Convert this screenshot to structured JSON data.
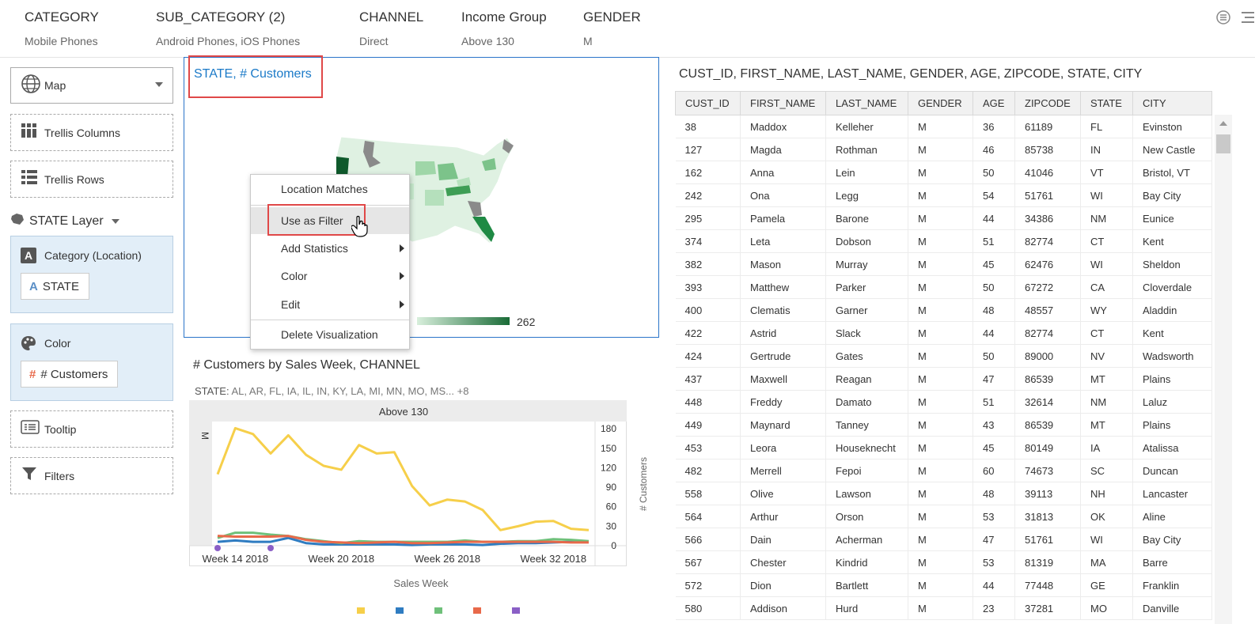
{
  "filters": [
    {
      "title": "CATEGORY",
      "value": "Mobile Phones"
    },
    {
      "title": "SUB_CATEGORY (2)",
      "value": "Android Phones, iOS Phones"
    },
    {
      "title": "CHANNEL",
      "value": "Direct"
    },
    {
      "title": "Income Group",
      "value": "Above 130"
    },
    {
      "title": "GENDER",
      "value": "M"
    }
  ],
  "left": {
    "map_label": "Map",
    "trellis_columns": "Trellis Columns",
    "trellis_rows": "Trellis Rows",
    "layer": "STATE Layer",
    "category_hdr": "Category (Location)",
    "category_pill": "STATE",
    "color_hdr": "Color",
    "color_pill": "# Customers",
    "tooltip": "Tooltip",
    "filters": "Filters"
  },
  "map": {
    "title": "STATE, # Customers",
    "legend_max": "262"
  },
  "context_menu": {
    "items": [
      "Location Matches",
      "Use as Filter",
      "Add Statistics",
      "Color",
      "Edit",
      "Delete Visualization"
    ]
  },
  "line": {
    "title": "# Customers by Sales Week, CHANNEL",
    "subtitle_label": "STATE:",
    "subtitle_value": "AL, AR, FL, IA, IL, IN, KY, LA, MI, MN, MO, MS... +8"
  },
  "chart_data": {
    "type": "line",
    "column_header": "Above 130",
    "row_header": "M",
    "xlabel": "Sales Week",
    "ylabel": "# Customers",
    "x_tick_labels": [
      "Week 14 2018",
      "Week 20 2018",
      "Week 26 2018",
      "Week 32 2018"
    ],
    "y_ticks": [
      0,
      30,
      60,
      90,
      120,
      150,
      180
    ],
    "ylim": [
      0,
      190
    ],
    "series": [
      {
        "color": "#f6cf4a",
        "values": [
          110,
          181,
          172,
          142,
          170,
          140,
          123,
          117,
          155,
          142,
          144,
          92,
          62,
          71,
          68,
          55,
          24,
          30,
          37,
          38,
          26,
          24
        ]
      },
      {
        "color": "#2f7cc1",
        "values": [
          6,
          8,
          6,
          6,
          12,
          4,
          2,
          2,
          2,
          2,
          2,
          1,
          2,
          2,
          2,
          1,
          3,
          4,
          4,
          5,
          6,
          6
        ]
      },
      {
        "color": "#6fc07a",
        "values": [
          12,
          20,
          20,
          17,
          15,
          10,
          7,
          4,
          7,
          6,
          6,
          6,
          6,
          6,
          8,
          6,
          6,
          7,
          7,
          10,
          9,
          7
        ]
      },
      {
        "color": "#e8694a",
        "values": [
          15,
          14,
          14,
          14,
          15,
          9,
          6,
          5,
          4,
          5,
          6,
          4,
          4,
          5,
          6,
          6,
          6,
          6,
          6,
          6,
          5,
          5
        ]
      },
      {
        "color": "#8a5fc6",
        "values": [
          0,
          null,
          null,
          0,
          null,
          null,
          null,
          null,
          null,
          null,
          null,
          null,
          null,
          null,
          null,
          null,
          null,
          null,
          null,
          null,
          null,
          null
        ]
      }
    ]
  },
  "table": {
    "title": "CUST_ID, FIRST_NAME, LAST_NAME, GENDER, AGE, ZIPCODE, STATE, CITY",
    "columns": [
      "CUST_ID",
      "FIRST_NAME",
      "LAST_NAME",
      "GENDER",
      "AGE",
      "ZIPCODE",
      "STATE",
      "CITY"
    ],
    "rows": [
      [
        "38",
        "Maddox",
        "Kelleher",
        "M",
        "36",
        "61189",
        "FL",
        "Evinston"
      ],
      [
        "127",
        "Magda",
        "Rothman",
        "M",
        "46",
        "85738",
        "IN",
        "New Castle"
      ],
      [
        "162",
        "Anna",
        "Lein",
        "M",
        "50",
        "41046",
        "VT",
        "Bristol, VT"
      ],
      [
        "242",
        "Ona",
        "Legg",
        "M",
        "54",
        "51761",
        "WI",
        "Bay City"
      ],
      [
        "295",
        "Pamela",
        "Barone",
        "M",
        "44",
        "34386",
        "NM",
        "Eunice"
      ],
      [
        "374",
        "Leta",
        "Dobson",
        "M",
        "51",
        "82774",
        "CT",
        "Kent"
      ],
      [
        "382",
        "Mason",
        "Murray",
        "M",
        "45",
        "62476",
        "WI",
        "Sheldon"
      ],
      [
        "393",
        "Matthew",
        "Parker",
        "M",
        "50",
        "67272",
        "CA",
        "Cloverdale"
      ],
      [
        "400",
        "Clematis",
        "Garner",
        "M",
        "48",
        "48557",
        "WY",
        "Aladdin"
      ],
      [
        "422",
        "Astrid",
        "Slack",
        "M",
        "44",
        "82774",
        "CT",
        "Kent"
      ],
      [
        "424",
        "Gertrude",
        "Gates",
        "M",
        "50",
        "89000",
        "NV",
        "Wadsworth"
      ],
      [
        "437",
        "Maxwell",
        "Reagan",
        "M",
        "47",
        "86539",
        "MT",
        "Plains"
      ],
      [
        "448",
        "Freddy",
        "Damato",
        "M",
        "51",
        "32614",
        "NM",
        "Laluz"
      ],
      [
        "449",
        "Maynard",
        "Tanney",
        "M",
        "43",
        "86539",
        "MT",
        "Plains"
      ],
      [
        "453",
        "Leora",
        "Houseknecht",
        "M",
        "45",
        "80149",
        "IA",
        "Atalissa"
      ],
      [
        "482",
        "Merrell",
        "Fepoi",
        "M",
        "60",
        "74673",
        "SC",
        "Duncan"
      ],
      [
        "558",
        "Olive",
        "Lawson",
        "M",
        "48",
        "39113",
        "NH",
        "Lancaster"
      ],
      [
        "564",
        "Arthur",
        "Orson",
        "M",
        "53",
        "31813",
        "OK",
        "Aline"
      ],
      [
        "566",
        "Dain",
        "Acherman",
        "M",
        "47",
        "51761",
        "WI",
        "Bay City"
      ],
      [
        "567",
        "Chester",
        "Kindrid",
        "M",
        "53",
        "81319",
        "MA",
        "Barre"
      ],
      [
        "572",
        "Dion",
        "Bartlett",
        "M",
        "44",
        "77448",
        "GE",
        "Franklin"
      ],
      [
        "580",
        "Addison",
        "Hurd",
        "M",
        "23",
        "37281",
        "MO",
        "Danville"
      ]
    ]
  }
}
